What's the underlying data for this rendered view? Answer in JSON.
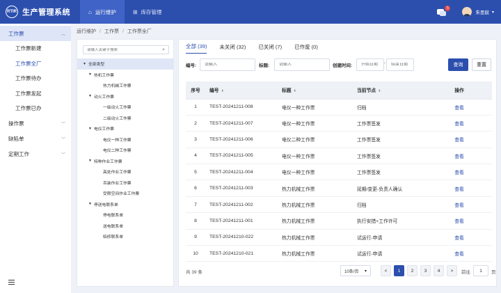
{
  "app": {
    "logo_text": "RTIR",
    "title": "生产管理系统",
    "nav": [
      {
        "label": "运行维护",
        "icon": "home-icon"
      },
      {
        "label": "库存管理",
        "icon": "warehouse-icon"
      }
    ],
    "message_count": "5",
    "username": "朱思宸"
  },
  "sidebar": {
    "groups": [
      {
        "label": "工作票",
        "items": [
          "工作票新建",
          "工作票全厂",
          "工作票待办",
          "工作票发起",
          "工作票已办"
        ]
      },
      {
        "label": "操作票"
      },
      {
        "label": "缺陷单"
      },
      {
        "label": "定期工作"
      }
    ]
  },
  "breadcrumb": [
    "运行维护",
    "工作票",
    "工作票全厂"
  ],
  "tree": {
    "search_placeholder": "请输入关键字搜索",
    "nodes": [
      "全部类型",
      "热机工作票",
      "热力机械工作票",
      "动火工作票",
      "一级动火工作票",
      "二级动火工作票",
      "电仪工作票",
      "电仪一种工作票",
      "电仪二种工作票",
      "特种作业工作票",
      "高处作业工作票",
      "吊装作业工作票",
      "受限空间作业工作票",
      "停送电联系单",
      "停电联系单",
      "送电联系单",
      "临修联系单"
    ]
  },
  "tabs": [
    "全部 (39)",
    "未关闭 (32)",
    "已关闭 (7)",
    "已作废 (0)"
  ],
  "filters": {
    "number_label": "编号:",
    "number_placeholder": "请输入",
    "title_label": "标题:",
    "title_placeholder": "请输入",
    "time_label": "创建时间:",
    "start_placeholder": "开始日期",
    "date_sep": "-",
    "end_placeholder": "结束日期",
    "query_button": "查询",
    "reset_button": "重置"
  },
  "table": {
    "headers": [
      "序号",
      "编号",
      "标题",
      "当前节点",
      "操作"
    ],
    "rows": [
      {
        "no": "1",
        "code": "TEST-20241211-008",
        "title": "电仪一种工作票",
        "node": "归档",
        "op": "查看"
      },
      {
        "no": "2",
        "code": "TEST-20241211-007",
        "title": "电仪一种工作票",
        "node": "工作票签发",
        "op": "查看"
      },
      {
        "no": "3",
        "code": "TEST-20241211-006",
        "title": "电仪二种工作票",
        "node": "工作票签发",
        "op": "查看"
      },
      {
        "no": "4",
        "code": "TEST-20241211-005",
        "title": "电仪一种工作票",
        "node": "工作票签发",
        "op": "查看"
      },
      {
        "no": "5",
        "code": "TEST-20241211-004",
        "title": "电仪一种工作票",
        "node": "工作票签发",
        "op": "查看"
      },
      {
        "no": "6",
        "code": "TEST-20241211-003",
        "title": "热力机械工作票",
        "node": "延期/变更-负责人确认",
        "op": "查看"
      },
      {
        "no": "7",
        "code": "TEST-20241211-002",
        "title": "热力机械工作票",
        "node": "归档",
        "op": "查看"
      },
      {
        "no": "8",
        "code": "TEST-20241211-001",
        "title": "热力机械工作票",
        "node": "执行安措+工作许可",
        "op": "查看"
      },
      {
        "no": "9",
        "code": "TEST-20241210-022",
        "title": "热力机械工作票",
        "node": "试运行-申请",
        "op": "查看"
      },
      {
        "no": "10",
        "code": "TEST-20241210-021",
        "title": "热力机械工作票",
        "node": "试运行-申请",
        "op": "查看"
      }
    ]
  },
  "pagination": {
    "total": "共 39 条",
    "page_size": "10条/页",
    "pages": [
      "1",
      "2",
      "3",
      "4"
    ],
    "current_page": "1",
    "goto_label": "前往",
    "goto_value": "1",
    "goto_unit": "页",
    "prev_symbol": "<",
    "next_symbol": ">"
  },
  "colors": {
    "primary": "#2c4fae",
    "bg": "#eef1f7"
  }
}
